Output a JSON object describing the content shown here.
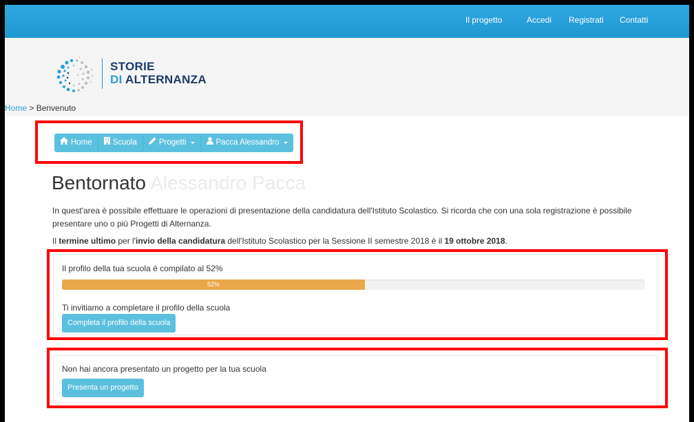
{
  "topnav": {
    "items": [
      "Il progetto",
      "Accedi",
      "Registrati",
      "Contatti"
    ]
  },
  "logo": {
    "line1": "STORIE",
    "line2_prefix": "DI",
    "line2_suffix": "ALTERNANZA"
  },
  "breadcrumb": {
    "home": "Home",
    "separator": " > ",
    "current": "Benvenuto"
  },
  "menu": {
    "items": [
      {
        "label": "Home",
        "icon": "home-icon",
        "dropdown": false
      },
      {
        "label": "Scuola",
        "icon": "building-icon",
        "dropdown": false
      },
      {
        "label": "Progetti",
        "icon": "pencil-icon",
        "dropdown": true
      },
      {
        "label": "Pacca Alessandro",
        "icon": "user-icon",
        "dropdown": true
      }
    ]
  },
  "welcome": {
    "greeting": "Bentornato",
    "name": "Alessandro Pacca"
  },
  "intro": "In quest'area è possibile effettuare le operazioni di presentazione della candidatura dell'Istituto Scolastico. Si ricorda che con una sola registrazione è possibile presentare uno o più Progetti di Alternanza.",
  "deadline": {
    "part1": "Il ",
    "bold1": "termine ultimo",
    "part2": " per l'",
    "bold2": "invio della candidatura",
    "part3": " dell'Istituto Scolastico per la Sessione II semestre 2018 è il ",
    "bold3": "19 ottobre 2018",
    "part4": "."
  },
  "profile_panel": {
    "status": "Il profilo della tua scuola è compilato al 52%",
    "progress_label": "52%",
    "progress_value": 52,
    "invite": "Ti invitiamo a completare il profilo della scuola",
    "button": "Completa il profilo della scuola"
  },
  "project_panel": {
    "status": "Non hai ancora presentato un progetto per la tua scuola",
    "button": "Presenta un progetto"
  },
  "colors": {
    "navbar": "#2a9fd6",
    "button": "#5bc0de",
    "progress": "#eaa84a",
    "highlight": "#ff0000"
  }
}
